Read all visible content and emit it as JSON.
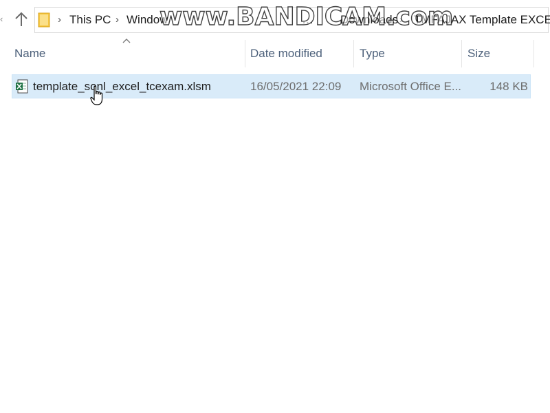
{
  "address_bar": {
    "breadcrumbs": [
      "This PC",
      "Window",
      "…",
      "Downloads",
      "TMFAJAX Template EXCEL"
    ],
    "up_icon": "arrow-up-icon",
    "folder_icon": "folder-icon"
  },
  "watermark": {
    "text": "www.BANDICAM.com"
  },
  "columns": {
    "name": "Name",
    "date_modified": "Date modified",
    "type": "Type",
    "size": "Size"
  },
  "files": [
    {
      "name": "template_sonl_excel_tcexam.xlsm",
      "date_modified": "16/05/2021 22:09",
      "type": "Microsoft Office E...",
      "size": "148 KB",
      "icon": "excel-file-icon",
      "selected": true
    }
  ],
  "colors": {
    "selection_bg": "#d9ebf9",
    "header_text": "#4c607a",
    "folder_yellow": "#f5c642",
    "excel_green": "#1f7244"
  }
}
